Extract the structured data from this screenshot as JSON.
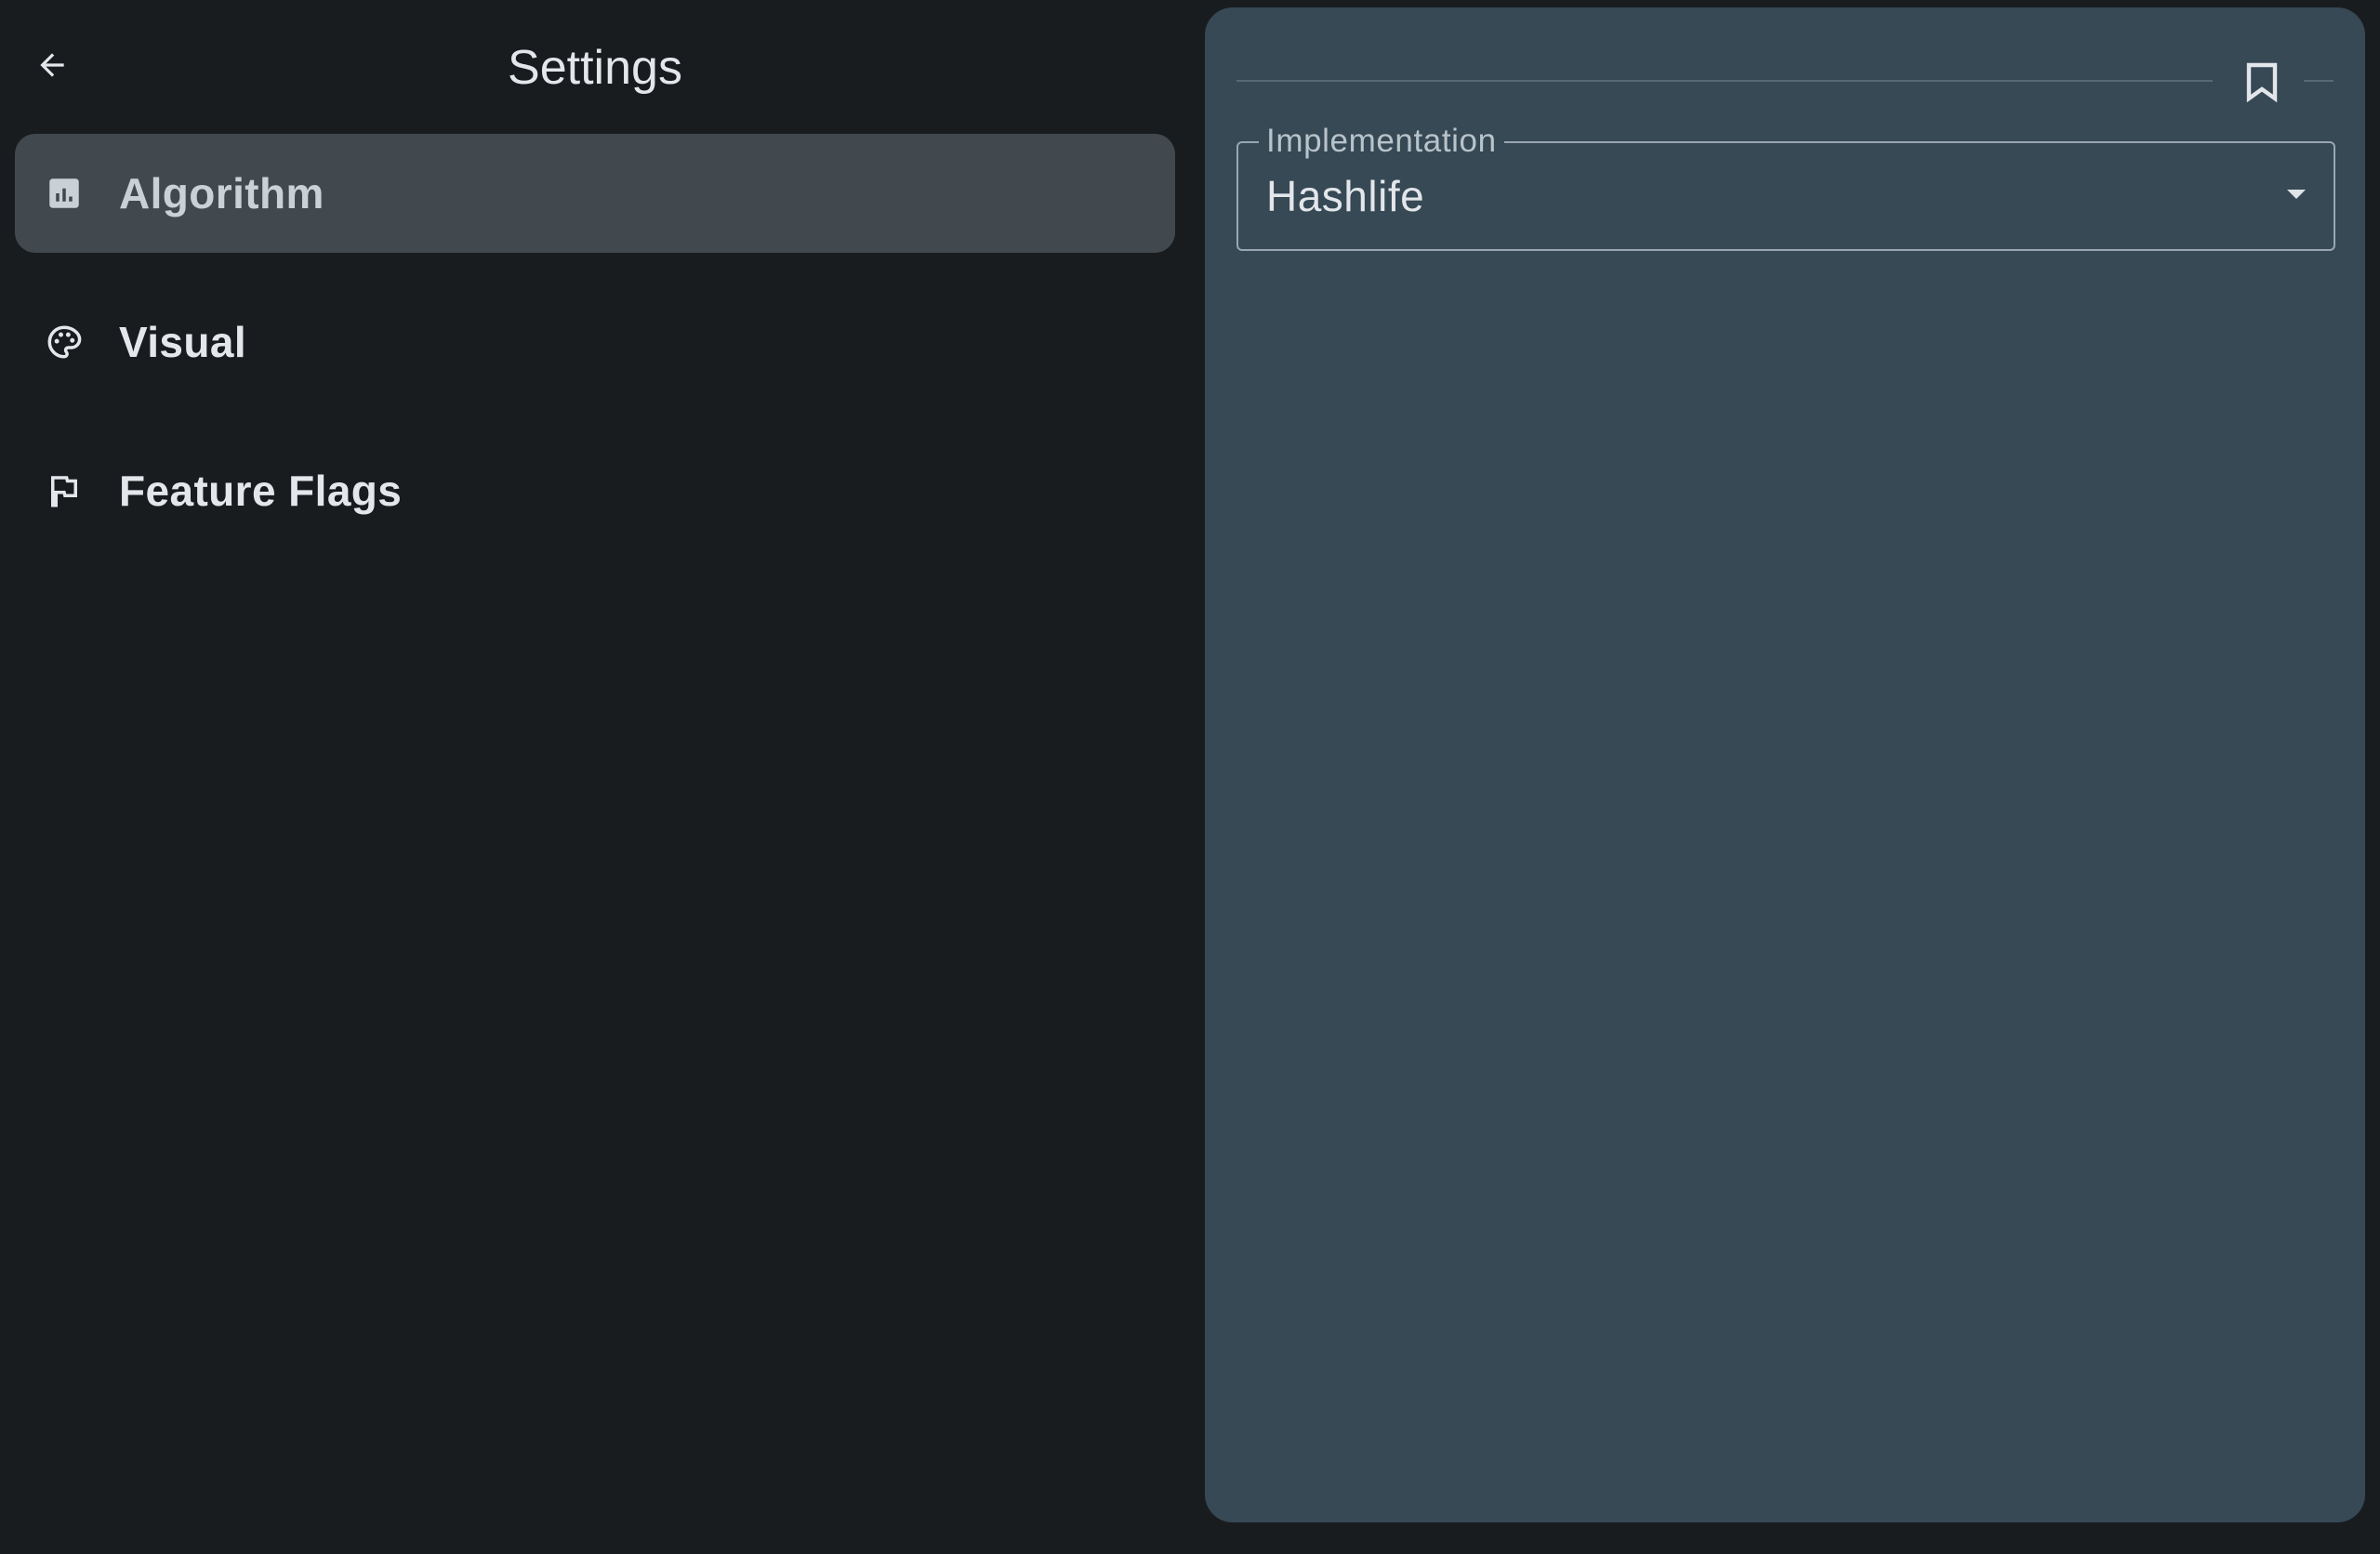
{
  "header": {
    "title": "Settings",
    "back_icon": "arrow-back-icon"
  },
  "nav": {
    "items": [
      {
        "label": "Algorithm",
        "icon": "bar-chart-icon",
        "selected": true
      },
      {
        "label": "Visual",
        "icon": "palette-icon",
        "selected": false
      },
      {
        "label": "Feature Flags",
        "icon": "flag-icon",
        "selected": false
      }
    ]
  },
  "detail": {
    "bookmark_icon": "bookmark-icon",
    "implementation": {
      "label": "Implementation",
      "value": "Hashlife",
      "dropdown_icon": "arrow-drop-down-icon"
    }
  },
  "colors": {
    "background": "#191c1f",
    "selected_item": "#41494f",
    "detail_panel": "#364955",
    "text_primary": "#e3e6ea"
  }
}
